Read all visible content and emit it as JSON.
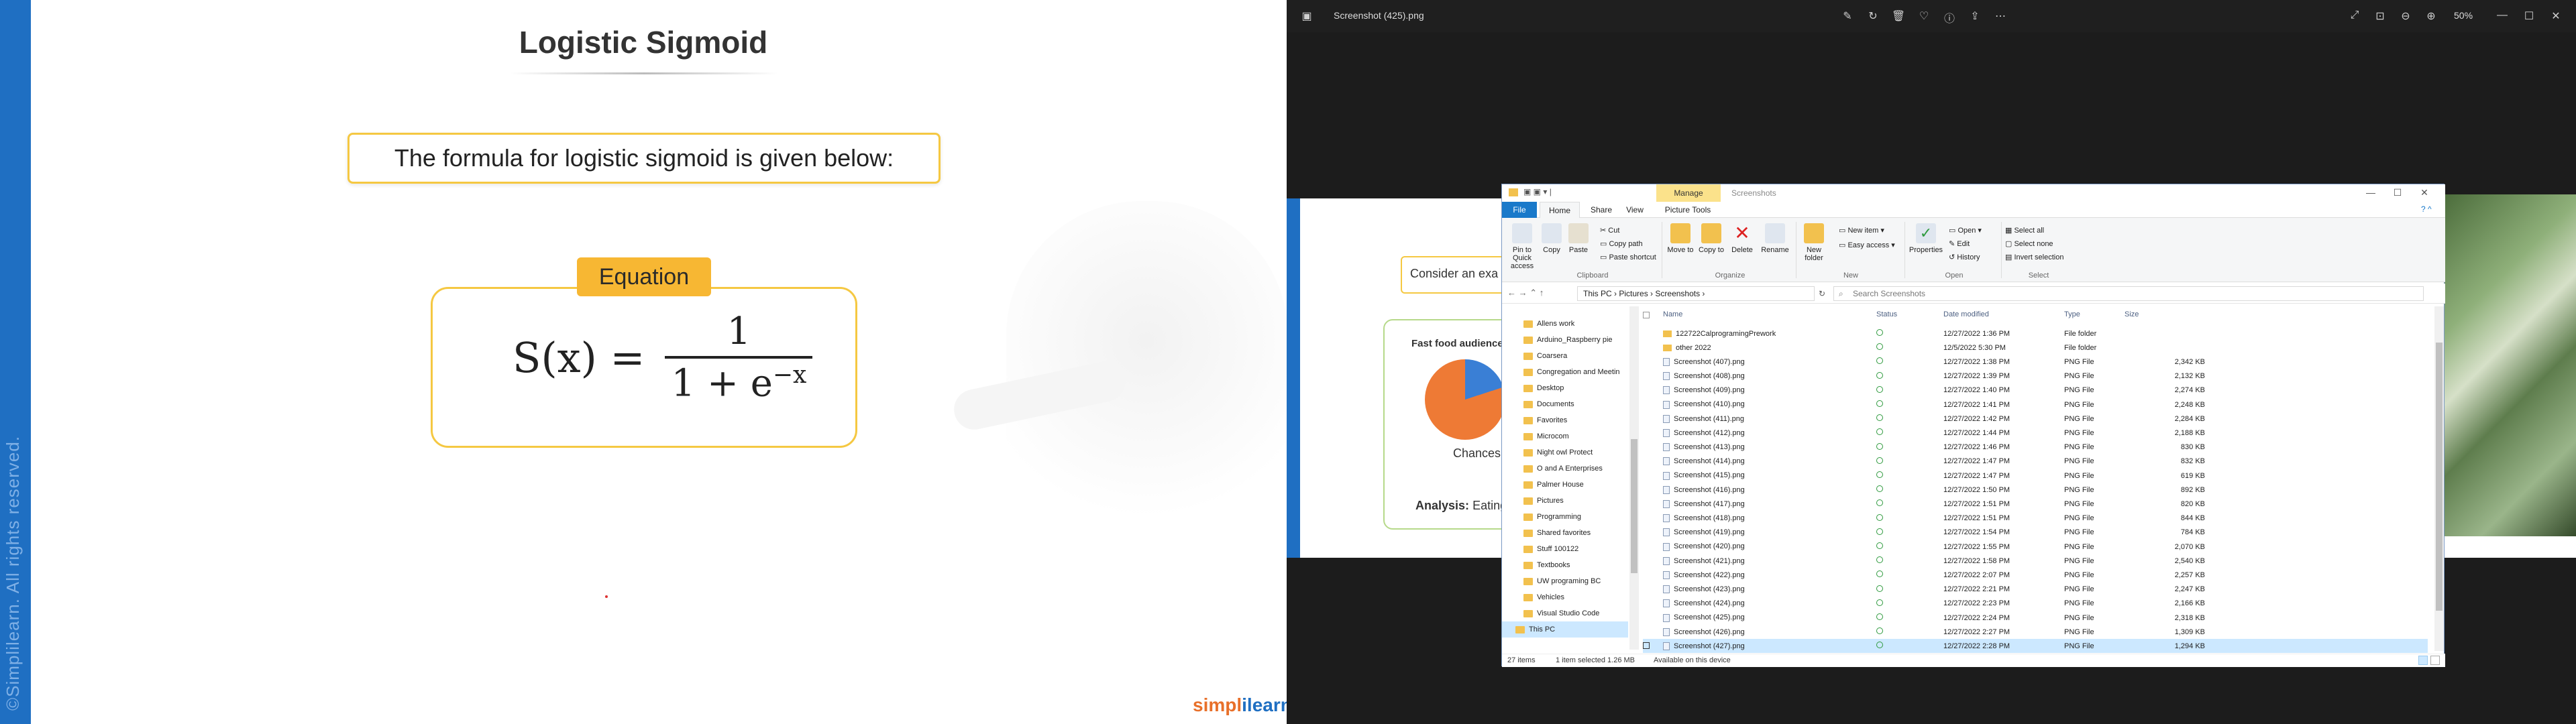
{
  "slide": {
    "title": "Logistic Sigmoid",
    "formula_caption": "The formula for logistic sigmoid is given below:",
    "equation_label": "Equation",
    "formula_lhs": "S(x) =",
    "formula_num": "1",
    "formula_den_base": "1 + e",
    "formula_den_exp": "−x",
    "copyright": "©Simplilearn. All rights reserved.",
    "logo_a": "simpl",
    "logo_b": "ilearn"
  },
  "viewer": {
    "file_title": "Screenshot (425).png",
    "zoom": "50%",
    "icons": [
      "edit-icon",
      "rotate-icon",
      "delete-icon",
      "favorite-icon",
      "info-icon",
      "share-icon",
      "more-icon"
    ],
    "bg_slide": {
      "consider_text": "Consider an exa",
      "card_title": "Fast food audience",
      "chances": "Chances o",
      "analysis_label": "Analysis:",
      "analysis_text": "Eating"
    }
  },
  "explorer": {
    "manage_tab": "Manage",
    "window_label": "Screenshots",
    "tabs": [
      "File",
      "Home",
      "Share",
      "View",
      "Picture Tools"
    ],
    "ribbon": {
      "clipboard": {
        "pin": "Pin to Quick access",
        "copy": "Copy",
        "paste": "Paste",
        "cut": "Cut",
        "copy_path": "Copy path",
        "paste_shortcut": "Paste shortcut",
        "group": "Clipboard"
      },
      "organize": {
        "move_to": "Move to",
        "copy_to": "Copy to",
        "delete": "Delete",
        "rename": "Rename",
        "group": "Organize"
      },
      "new": {
        "new_folder": "New folder",
        "new_item": "New item",
        "easy_access": "Easy access",
        "group": "New"
      },
      "open": {
        "properties": "Properties",
        "open": "Open",
        "edit": "Edit",
        "history": "History",
        "group": "Open"
      },
      "select": {
        "select_all": "Select all",
        "select_none": "Select none",
        "invert": "Invert selection",
        "group": "Select"
      }
    },
    "breadcrumb": [
      "This PC",
      "Pictures",
      "Screenshots"
    ],
    "search_placeholder": "Search Screenshots",
    "columns": [
      "Name",
      "Status",
      "Date modified",
      "Type",
      "Size"
    ],
    "nav": [
      "Allens work",
      "Arduino_Raspberry pie",
      "Coarsera",
      "Congregation and Meetin",
      "Desktop",
      "Documents",
      "Favorites",
      "Microcom",
      "Night owl Protect",
      "O and A Enterprises",
      "Palmer House",
      "Pictures",
      "Programming",
      "Shared favorites",
      "Stuff 100122",
      "Textbooks",
      "UW programing BC",
      "Vehicles",
      "Visual Studio Code",
      "This PC"
    ],
    "rows": [
      {
        "name": "122722CalprogramingPrework",
        "date": "12/27/2022 1:36 PM",
        "type": "File folder",
        "size": "",
        "folder": true
      },
      {
        "name": "other 2022",
        "date": "12/5/2022 5:30 PM",
        "type": "File folder",
        "size": "",
        "folder": true
      },
      {
        "name": "Screenshot (407).png",
        "date": "12/27/2022 1:38 PM",
        "type": "PNG File",
        "size": "2,342 KB"
      },
      {
        "name": "Screenshot (408).png",
        "date": "12/27/2022 1:39 PM",
        "type": "PNG File",
        "size": "2,132 KB"
      },
      {
        "name": "Screenshot (409).png",
        "date": "12/27/2022 1:40 PM",
        "type": "PNG File",
        "size": "2,274 KB"
      },
      {
        "name": "Screenshot (410).png",
        "date": "12/27/2022 1:41 PM",
        "type": "PNG File",
        "size": "2,248 KB"
      },
      {
        "name": "Screenshot (411).png",
        "date": "12/27/2022 1:42 PM",
        "type": "PNG File",
        "size": "2,284 KB"
      },
      {
        "name": "Screenshot (412).png",
        "date": "12/27/2022 1:44 PM",
        "type": "PNG File",
        "size": "2,188 KB"
      },
      {
        "name": "Screenshot (413).png",
        "date": "12/27/2022 1:46 PM",
        "type": "PNG File",
        "size": "830 KB"
      },
      {
        "name": "Screenshot (414).png",
        "date": "12/27/2022 1:47 PM",
        "type": "PNG File",
        "size": "832 KB"
      },
      {
        "name": "Screenshot (415).png",
        "date": "12/27/2022 1:47 PM",
        "type": "PNG File",
        "size": "619 KB"
      },
      {
        "name": "Screenshot (416).png",
        "date": "12/27/2022 1:50 PM",
        "type": "PNG File",
        "size": "892 KB"
      },
      {
        "name": "Screenshot (417).png",
        "date": "12/27/2022 1:51 PM",
        "type": "PNG File",
        "size": "820 KB"
      },
      {
        "name": "Screenshot (418).png",
        "date": "12/27/2022 1:51 PM",
        "type": "PNG File",
        "size": "844 KB"
      },
      {
        "name": "Screenshot (419).png",
        "date": "12/27/2022 1:54 PM",
        "type": "PNG File",
        "size": "784 KB"
      },
      {
        "name": "Screenshot (420).png",
        "date": "12/27/2022 1:55 PM",
        "type": "PNG File",
        "size": "2,070 KB"
      },
      {
        "name": "Screenshot (421).png",
        "date": "12/27/2022 1:58 PM",
        "type": "PNG File",
        "size": "2,540 KB"
      },
      {
        "name": "Screenshot (422).png",
        "date": "12/27/2022 2:07 PM",
        "type": "PNG File",
        "size": "2,257 KB"
      },
      {
        "name": "Screenshot (423).png",
        "date": "12/27/2022 2:21 PM",
        "type": "PNG File",
        "size": "2,247 KB"
      },
      {
        "name": "Screenshot (424).png",
        "date": "12/27/2022 2:23 PM",
        "type": "PNG File",
        "size": "2,166 KB"
      },
      {
        "name": "Screenshot (425).png",
        "date": "12/27/2022 2:24 PM",
        "type": "PNG File",
        "size": "2,318 KB"
      },
      {
        "name": "Screenshot (426).png",
        "date": "12/27/2022 2:27 PM",
        "type": "PNG File",
        "size": "1,309 KB"
      },
      {
        "name": "Screenshot (427).png",
        "date": "12/27/2022 2:28 PM",
        "type": "PNG File",
        "size": "1,294 KB",
        "selected": true
      }
    ],
    "status_count": "27 items",
    "status_selected": "1 item selected  1.26 MB",
    "status_available": "Available on this device"
  }
}
